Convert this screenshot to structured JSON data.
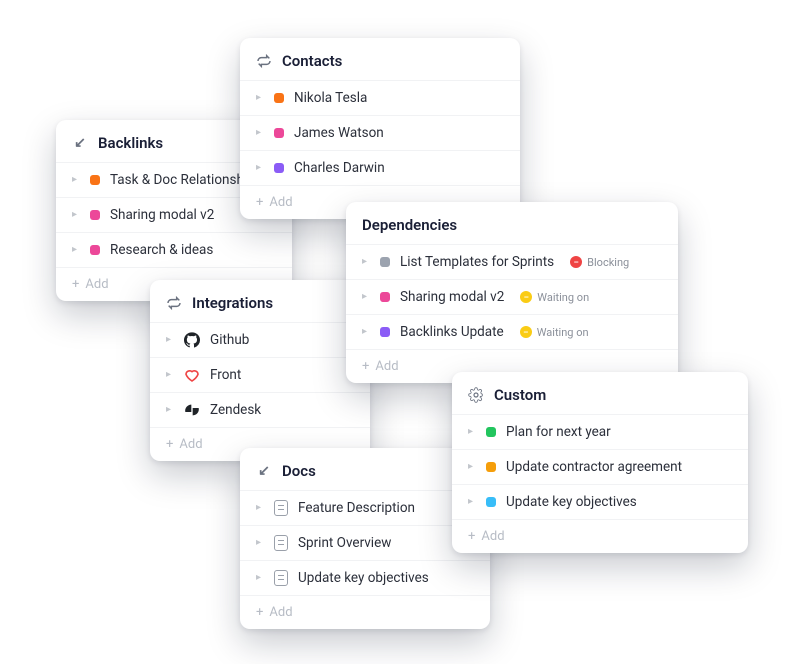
{
  "shared": {
    "add_label": "Add"
  },
  "colors": {
    "orange": "#f97316",
    "pink": "#ec4899",
    "purple": "#8b5cf6",
    "green": "#22c55e",
    "amber": "#f59e0b",
    "sky": "#38bdf8",
    "grey": "#9ca3af",
    "red_badge": "#ef4444",
    "yellow_badge": "#facc15"
  },
  "cards": {
    "contacts": {
      "title": "Contacts",
      "items": [
        {
          "label": "Nikola Tesla",
          "color": "orange"
        },
        {
          "label": "James Watson",
          "color": "pink"
        },
        {
          "label": "Charles Darwin",
          "color": "purple"
        }
      ]
    },
    "backlinks": {
      "title": "Backlinks",
      "items": [
        {
          "label": "Task & Doc Relationships",
          "color": "orange"
        },
        {
          "label": "Sharing modal v2",
          "color": "pink"
        },
        {
          "label": "Research & ideas",
          "color": "pink"
        }
      ]
    },
    "dependencies": {
      "title": "Dependencies",
      "items": [
        {
          "label": "List Templates for Sprints",
          "color": "grey",
          "status": "Blocking",
          "status_color": "red_badge",
          "status_glyph": "–"
        },
        {
          "label": "Sharing modal v2",
          "color": "pink",
          "status": "Waiting on",
          "status_color": "yellow_badge",
          "status_glyph": "–"
        },
        {
          "label": "Backlinks Update",
          "color": "purple",
          "status": "Waiting on",
          "status_color": "yellow_badge",
          "status_glyph": "–"
        }
      ]
    },
    "integrations": {
      "title": "Integrations",
      "items": [
        {
          "label": "Github",
          "icon": "github"
        },
        {
          "label": "Front",
          "icon": "front"
        },
        {
          "label": "Zendesk",
          "icon": "zendesk"
        }
      ]
    },
    "custom": {
      "title": "Custom",
      "items": [
        {
          "label": "Plan for next year",
          "color": "green"
        },
        {
          "label": "Update contractor agreement",
          "color": "amber"
        },
        {
          "label": "Update key objectives",
          "color": "sky"
        }
      ]
    },
    "docs": {
      "title": "Docs",
      "items": [
        {
          "label": "Feature Description"
        },
        {
          "label": "Sprint Overview"
        },
        {
          "label": "Update key objectives"
        }
      ]
    }
  }
}
